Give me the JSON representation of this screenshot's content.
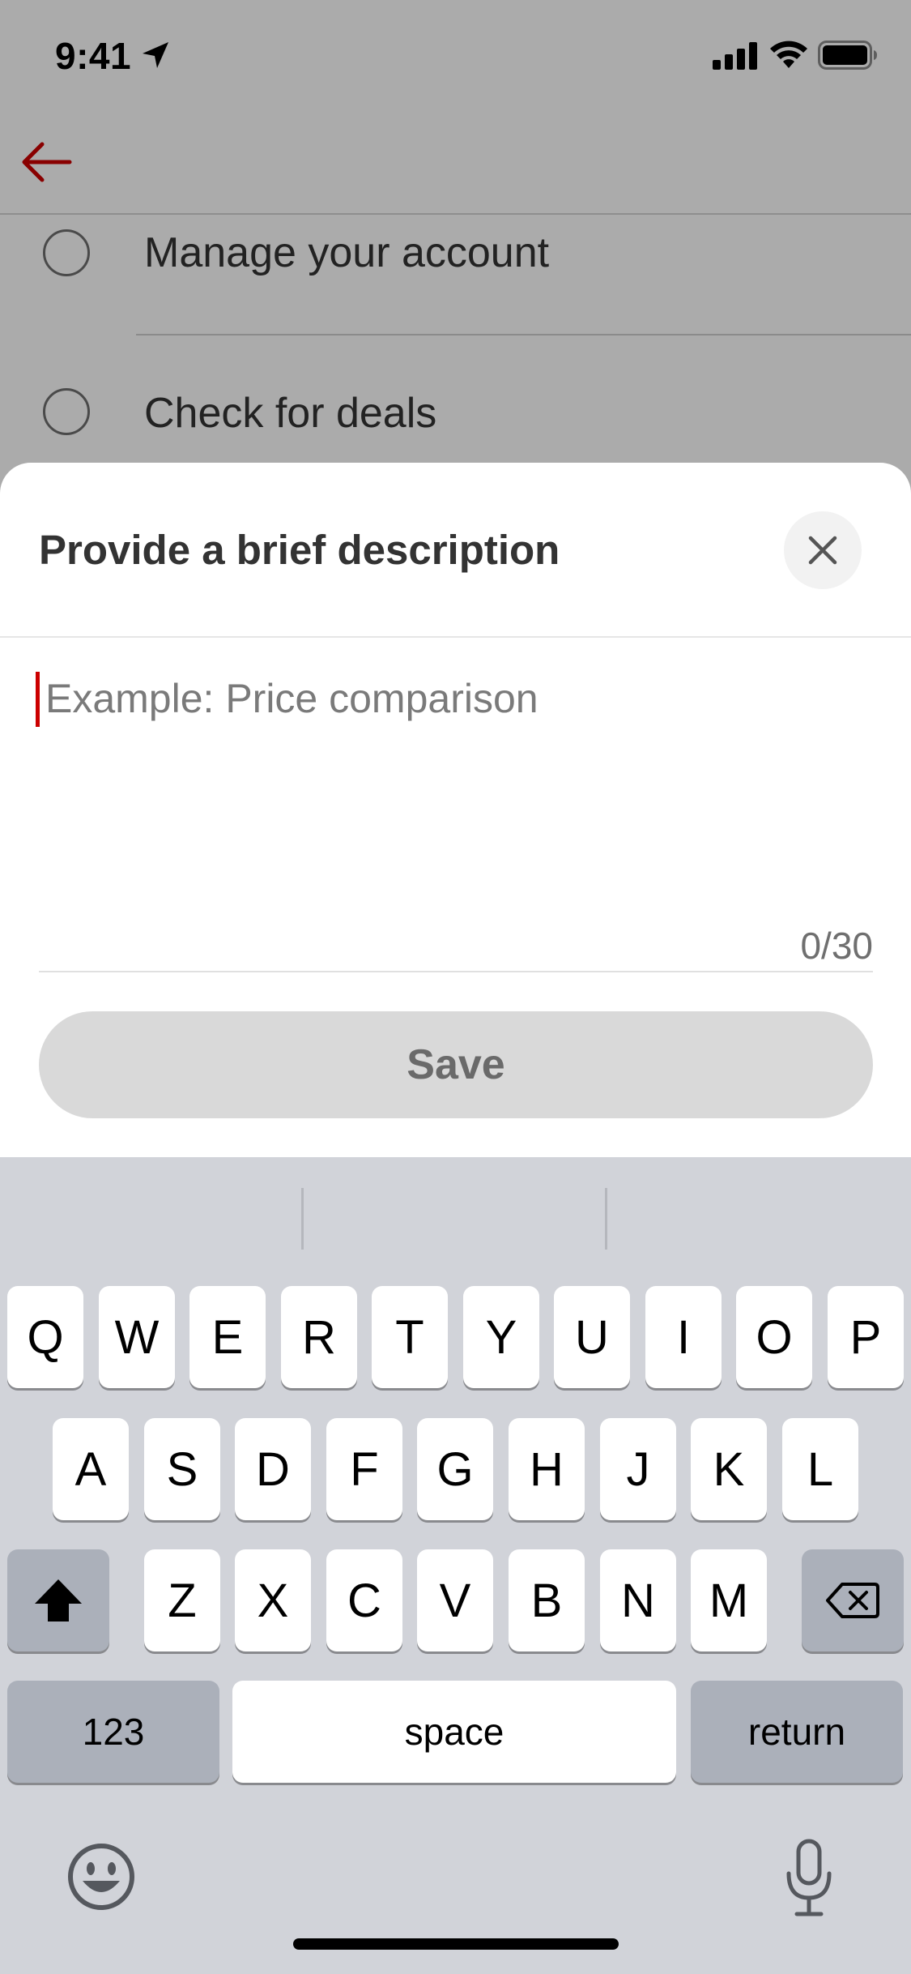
{
  "status_bar": {
    "time": "9:41",
    "location_icon": "location-arrow-icon",
    "signal_icon": "cellular-signal-icon",
    "wifi_icon": "wifi-icon",
    "battery_icon": "battery-icon"
  },
  "nav": {
    "back_icon": "back-arrow-icon",
    "accent": "#cc0000"
  },
  "options": [
    {
      "label": "Manage your account"
    },
    {
      "label": "Check for deals"
    }
  ],
  "sheet": {
    "title": "Provide a brief description",
    "close_icon": "close-icon",
    "input": {
      "value": "",
      "placeholder": "Example: Price comparison"
    },
    "char_count": "0/30",
    "save_label": "Save"
  },
  "keyboard": {
    "row1": [
      "Q",
      "W",
      "E",
      "R",
      "T",
      "Y",
      "U",
      "I",
      "O",
      "P"
    ],
    "row2": [
      "A",
      "S",
      "D",
      "F",
      "G",
      "H",
      "J",
      "K",
      "L"
    ],
    "row3": [
      "Z",
      "X",
      "C",
      "V",
      "B",
      "N",
      "M"
    ],
    "shift_icon": "shift-icon",
    "delete_icon": "backspace-icon",
    "numbers_label": "123",
    "space_label": "space",
    "return_label": "return",
    "emoji_icon": "emoji-icon",
    "mic_icon": "microphone-icon"
  }
}
